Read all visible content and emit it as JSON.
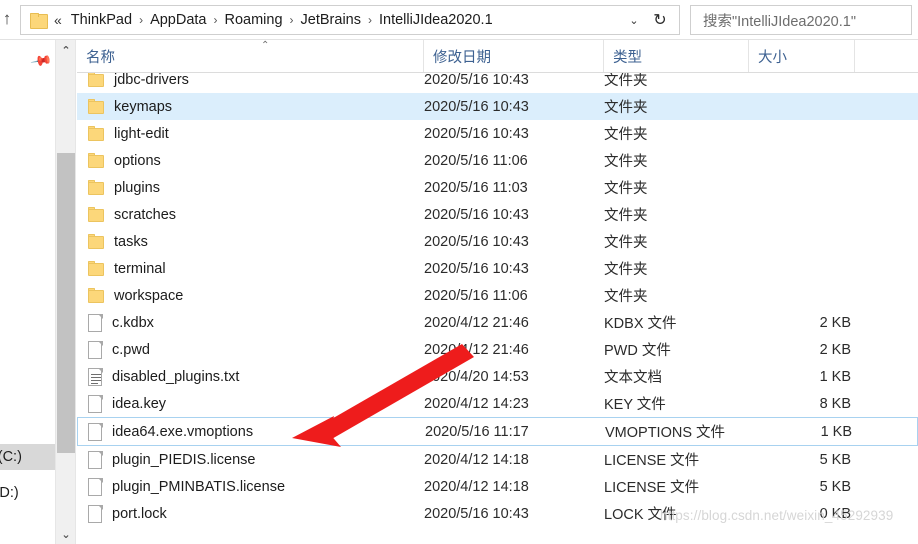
{
  "window": {
    "colors": {
      "folder_yellow": "#fcd77a",
      "header_text_blue": "#3d6191",
      "hover_row": "#dbeefc",
      "focus_border": "#a8d2f0",
      "annotation_red": "#ee1c1c"
    }
  },
  "addressbar": {
    "up_button": "↑",
    "prefix": "«",
    "crumbs": [
      "ThinkPad",
      "AppData",
      "Roaming",
      "JetBrains",
      "IntelliJIdea2020.1"
    ],
    "separator": "›",
    "dropdown": "⌄",
    "refresh": "↻"
  },
  "search": {
    "placeholder": "搜索\"IntelliJIdea2020.1\""
  },
  "navpane": {
    "pin": "📌",
    "entries": [
      {
        "label": "ws (C:)",
        "selected": true
      },
      {
        "label": "盘 (D:)",
        "selected": false
      }
    ],
    "scroll_up": "⌃",
    "scroll_down": "⌄"
  },
  "columns": [
    {
      "key": "name",
      "label": "名称"
    },
    {
      "key": "date",
      "label": "修改日期"
    },
    {
      "key": "type",
      "label": "类型"
    },
    {
      "key": "size",
      "label": "大小"
    }
  ],
  "sort_indicator": "⌃",
  "rows": [
    {
      "name": "jdbc-drivers",
      "date": "2020/5/16 10:43",
      "type": "文件夹",
      "size": "",
      "icon": "folder",
      "state": "clipped"
    },
    {
      "name": "keymaps",
      "date": "2020/5/16 10:43",
      "type": "文件夹",
      "size": "",
      "icon": "folder",
      "state": "hover"
    },
    {
      "name": "light-edit",
      "date": "2020/5/16 10:43",
      "type": "文件夹",
      "size": "",
      "icon": "folder",
      "state": ""
    },
    {
      "name": "options",
      "date": "2020/5/16 11:06",
      "type": "文件夹",
      "size": "",
      "icon": "folder",
      "state": ""
    },
    {
      "name": "plugins",
      "date": "2020/5/16 11:03",
      "type": "文件夹",
      "size": "",
      "icon": "folder",
      "state": ""
    },
    {
      "name": "scratches",
      "date": "2020/5/16 10:43",
      "type": "文件夹",
      "size": "",
      "icon": "folder",
      "state": ""
    },
    {
      "name": "tasks",
      "date": "2020/5/16 10:43",
      "type": "文件夹",
      "size": "",
      "icon": "folder",
      "state": ""
    },
    {
      "name": "terminal",
      "date": "2020/5/16 10:43",
      "type": "文件夹",
      "size": "",
      "icon": "folder",
      "state": ""
    },
    {
      "name": "workspace",
      "date": "2020/5/16 11:06",
      "type": "文件夹",
      "size": "",
      "icon": "folder",
      "state": ""
    },
    {
      "name": "c.kdbx",
      "date": "2020/4/12 21:46",
      "type": "KDBX 文件",
      "size": "2 KB",
      "icon": "file",
      "state": ""
    },
    {
      "name": "c.pwd",
      "date": "2020/4/12 21:46",
      "type": "PWD 文件",
      "size": "2 KB",
      "icon": "file",
      "state": ""
    },
    {
      "name": "disabled_plugins.txt",
      "date": "2020/4/20 14:53",
      "type": "文本文档",
      "size": "1 KB",
      "icon": "file-lined",
      "state": ""
    },
    {
      "name": "idea.key",
      "date": "2020/4/12 14:23",
      "type": "KEY 文件",
      "size": "8 KB",
      "icon": "file",
      "state": ""
    },
    {
      "name": "idea64.exe.vmoptions",
      "date": "2020/5/16 11:17",
      "type": "VMOPTIONS 文件",
      "size": "1 KB",
      "icon": "file",
      "state": "focus"
    },
    {
      "name": "plugin_PIEDIS.license",
      "date": "2020/4/12 14:18",
      "type": "LICENSE 文件",
      "size": "5 KB",
      "icon": "file",
      "state": ""
    },
    {
      "name": "plugin_PMINBATIS.license",
      "date": "2020/4/12 14:18",
      "type": "LICENSE 文件",
      "size": "5 KB",
      "icon": "file",
      "state": ""
    },
    {
      "name": "port.lock",
      "date": "2020/5/16 10:43",
      "type": "LOCK 文件",
      "size": "0 KB",
      "icon": "file",
      "state": ""
    }
  ],
  "annotation": {
    "type": "red-arrow",
    "points_to": "idea64.exe.vmoptions"
  },
  "watermark": {
    "text": "https://blog.csdn.net/weixin_45292939"
  }
}
